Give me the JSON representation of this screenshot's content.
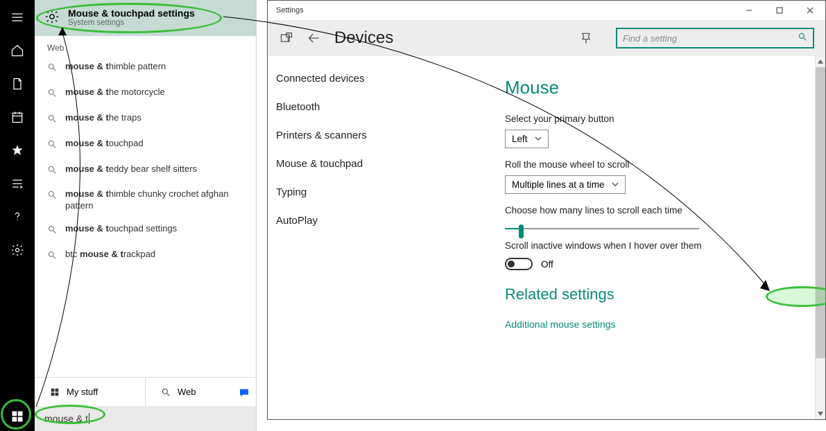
{
  "left_rail_icons": [
    "menu",
    "home",
    "document",
    "calendar",
    "star",
    "list",
    "help",
    "gear"
  ],
  "start": {
    "top_title": "Mouse & touchpad settings",
    "top_subtitle": "System settings",
    "web_heading": "Web",
    "results": [
      {
        "prefix": "mouse & t",
        "suffix": "himble pattern"
      },
      {
        "prefix": "mouse & t",
        "suffix": "he motorcycle"
      },
      {
        "prefix": "mouse & t",
        "suffix": "he traps"
      },
      {
        "prefix": "mouse & t",
        "suffix": "ouchpad"
      },
      {
        "prefix": "mouse & t",
        "suffix": "eddy bear shelf sitters"
      },
      {
        "prefix": "mouse & t",
        "suffix": "himble chunky crochet afghan pattern"
      },
      {
        "prefix": "mouse & t",
        "suffix": "ouchpad settings"
      },
      {
        "prefix_plain": "btc ",
        "prefix": "mouse & t",
        "suffix": "rackpad"
      }
    ],
    "tabs": {
      "mystuff": "My stuff",
      "web": "Web"
    },
    "search_value": "mouse & t"
  },
  "settings": {
    "window_title": "Settings",
    "page_title": "Devices",
    "search_placeholder": "Find a setting",
    "nav": [
      "Connected devices",
      "Bluetooth",
      "Printers & scanners",
      "Mouse & touchpad",
      "Typing",
      "AutoPlay"
    ],
    "main": {
      "heading": "Mouse",
      "primary_label": "Select your primary button",
      "primary_value": "Left",
      "scroll_label": "Roll the mouse wheel to scroll",
      "scroll_value": "Multiple lines at a time",
      "lines_label": "Choose how many lines to scroll each time",
      "inactive_label": "Scroll inactive windows when I hover over them",
      "toggle_value": "Off",
      "related_heading": "Related settings",
      "related_link": "Additional mouse settings"
    }
  }
}
